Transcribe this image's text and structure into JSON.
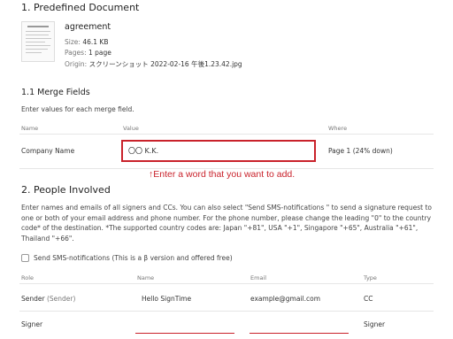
{
  "section1": {
    "title": "1. Predefined Document",
    "doc_name": "agreement",
    "size_label": "Size:",
    "size_value": "46.1 KB",
    "pages_label": "Pages:",
    "pages_value": "1 page",
    "origin_label": "Origin:",
    "origin_value": "スクリーンショット 2022-02-16 午後1.23.42.jpg"
  },
  "merge": {
    "title": "1.1 Merge Fields",
    "instruction": "Enter values for each merge field.",
    "col_name": "Name",
    "col_value": "Value",
    "col_where": "Where",
    "field_name": "Company Name",
    "field_value": "〇〇 K.K.",
    "field_where": "Page 1 (24% down)"
  },
  "annotation": "↑Enter a word that you want to add.",
  "section2": {
    "title": "2. People Involved",
    "paragraph": "Enter names and emails of all signers and CCs. You can also select \"Send SMS-notifications \" to send a signature request to one or both of your email address and phone number. For the phone number, please change the leading \"0\" to the country code* of the destination. *The supported country codes are: Japan \"+81\", USA \"+1\", Singapore \"+65\", Australia \"+61\", Thailand \"+66\".",
    "sms_label": "Send SMS-notifications (This is a β version and offered free)",
    "col_role": "Role",
    "col_name": "Name",
    "col_email": "Email",
    "col_type": "Type",
    "rows": [
      {
        "role": "Sender",
        "role_note": "(Sender)",
        "name": "Hello SignTime",
        "email": "example@gmail.com",
        "type": "CC"
      },
      {
        "role": "Signer",
        "role_note": "",
        "name": "",
        "email": "",
        "type": "Signer"
      }
    ]
  },
  "colors": {
    "accent": "#c9222b",
    "text": "#333333",
    "muted": "#777777"
  }
}
